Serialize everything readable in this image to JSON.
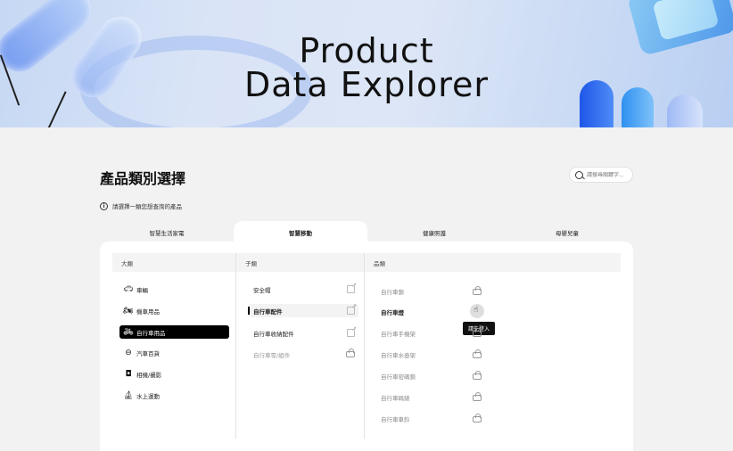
{
  "hero": {
    "title_line1": "Product",
    "title_line2": "Data Explorer"
  },
  "section_title": "產品類別選擇",
  "search": {
    "placeholder": "請搜尋關鍵字..."
  },
  "hint": "請選擇一類您想查詢的產品",
  "tabs": [
    {
      "label": "智慧生活家電",
      "active": false
    },
    {
      "label": "智慧移動",
      "active": true
    },
    {
      "label": "健康照護",
      "active": false
    },
    {
      "label": "母嬰兒童",
      "active": false
    }
  ],
  "columns": {
    "category": "大類",
    "subcategory": "子類",
    "product": "品類"
  },
  "categories": [
    {
      "label": "車輛",
      "icon": "car-icon"
    },
    {
      "label": "機車用品",
      "icon": "motorcycle-icon"
    },
    {
      "label": "自行車用品",
      "icon": "bicycle-icon",
      "active": true
    },
    {
      "label": "汽車百貨",
      "icon": "steering-wheel-icon"
    },
    {
      "label": "相機/攝影",
      "icon": "camera-icon"
    },
    {
      "label": "水上運動",
      "icon": "boat-icon"
    }
  ],
  "subcategories": [
    {
      "label": "安全帽",
      "state": "normal"
    },
    {
      "label": "自行車配件",
      "state": "active"
    },
    {
      "label": "自行車收納配件",
      "state": "normal"
    },
    {
      "label": "自行車零/組件",
      "state": "locked"
    }
  ],
  "products": [
    {
      "label": "自行車鎖"
    },
    {
      "label": "自行車燈",
      "hovered": true
    },
    {
      "label": "自行車手機架"
    },
    {
      "label": "自行車水壺架"
    },
    {
      "label": "自行車密碼鎖"
    },
    {
      "label": "自行車碼錶"
    },
    {
      "label": "自行車車鈴"
    }
  ],
  "tooltip": "請先登入"
}
